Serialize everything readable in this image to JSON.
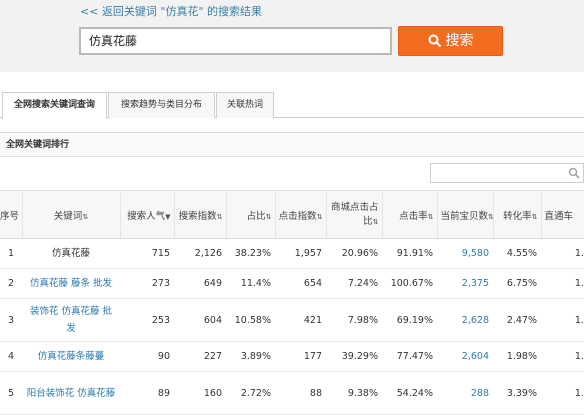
{
  "header": {
    "back_link": "<< 返回关键词 \"仿真花\" 的搜索结果",
    "search_value": "仿真花藤",
    "search_button": "搜索"
  },
  "tabs": [
    {
      "label": "全网搜索关键词查询",
      "active": true
    },
    {
      "label": "搜索趋势与类目分布",
      "active": false
    },
    {
      "label": "关联热词",
      "active": false
    }
  ],
  "panel_title": "全网关键词排行",
  "table": {
    "headers": {
      "index": "序号",
      "keyword": "关键词",
      "popularity": "搜索人气",
      "index_value": "搜索指数",
      "share": "占比",
      "click_index": "点击指数",
      "mall_click_line1": "商城点击占",
      "mall_click_line2": "比",
      "ctr": "点击率",
      "items": "当前宝贝数",
      "conversion": "转化率",
      "direct": "直通车"
    },
    "rows": [
      {
        "index": "1",
        "keyword": "仿真花藤",
        "popularity": "715",
        "search_index": "2,126",
        "share": "38.23%",
        "click_index": "1,957",
        "mall_click": "20.96%",
        "ctr": "91.91%",
        "items": "9,580",
        "conversion": "4.55%",
        "direct": "1.75"
      },
      {
        "index": "2",
        "keyword": "仿真花藤 藤条 批发",
        "popularity": "273",
        "search_index": "649",
        "share": "11.4%",
        "click_index": "654",
        "mall_click": "7.24%",
        "ctr": "100.67%",
        "items": "2,375",
        "conversion": "6.75%",
        "direct": "1.21"
      },
      {
        "index": "3",
        "keyword": "装饰花 仿真花藤 批发",
        "popularity": "253",
        "search_index": "604",
        "share": "10.58%",
        "click_index": "421",
        "mall_click": "7.98%",
        "ctr": "69.19%",
        "items": "2,628",
        "conversion": "2.47%",
        "direct": "1.15"
      },
      {
        "index": "4",
        "keyword": "仿真花藤条藤蔓",
        "popularity": "90",
        "search_index": "227",
        "share": "3.89%",
        "click_index": "177",
        "mall_click": "39.29%",
        "ctr": "77.47%",
        "items": "2,604",
        "conversion": "1.98%",
        "direct": "1.47"
      },
      {
        "index": "5",
        "keyword": "阳台装饰花 仿真花藤",
        "popularity": "89",
        "search_index": "160",
        "share": "2.72%",
        "click_index": "88",
        "mall_click": "9.38%",
        "ctr": "54.24%",
        "items": "288",
        "conversion": "3.39%",
        "direct": "1.57"
      }
    ]
  },
  "colors": {
    "accent": "#f36c1f",
    "link": "#2d7bb0"
  }
}
